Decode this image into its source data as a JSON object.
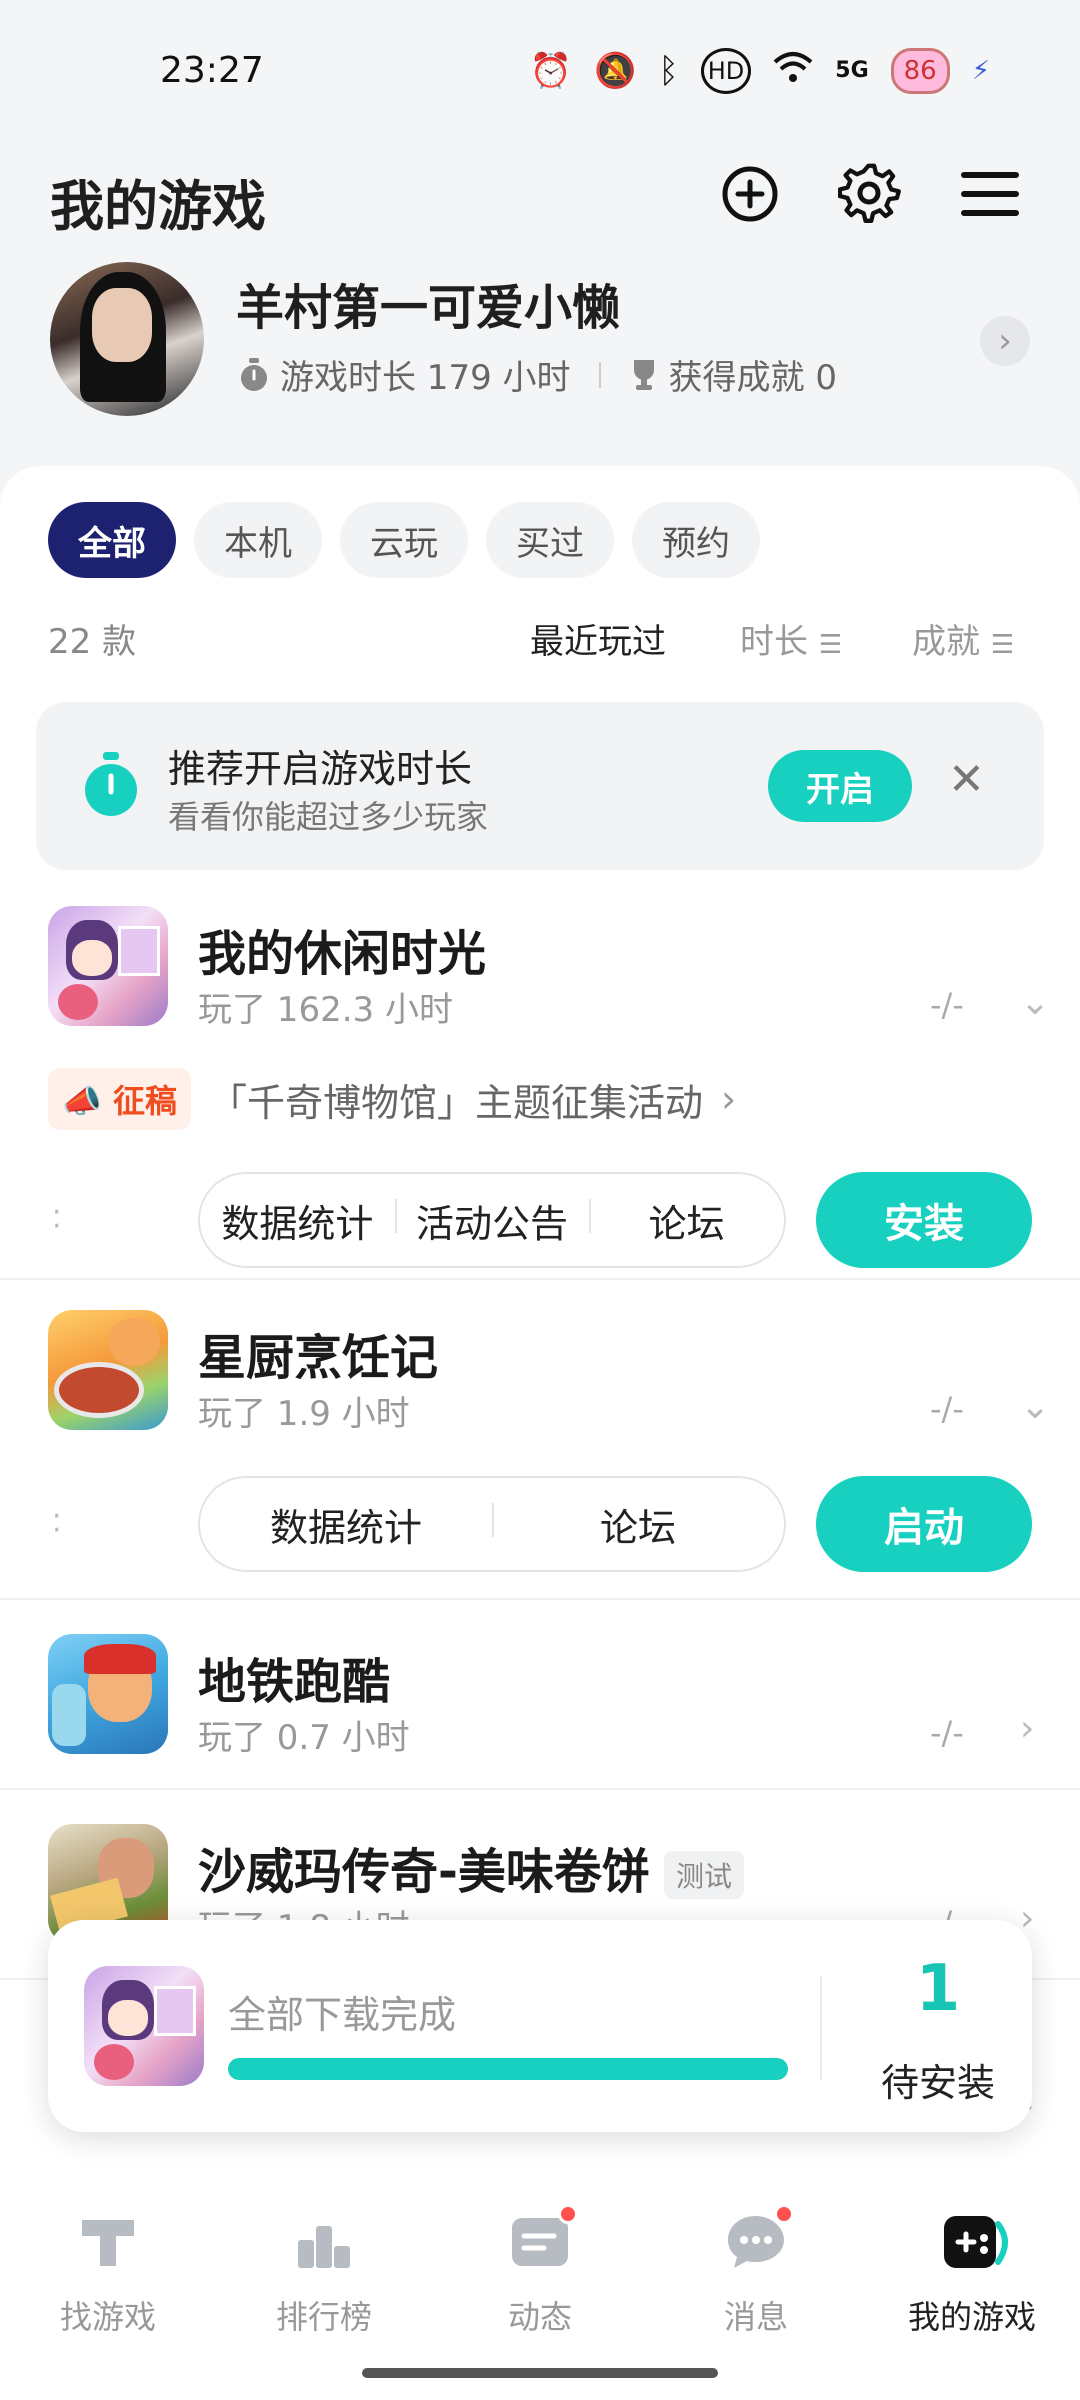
{
  "status_bar": {
    "time": "23:27",
    "network": "5G",
    "battery": "86"
  },
  "header": {
    "title": "我的游戏"
  },
  "profile": {
    "name": "羊村第一可爱小懒",
    "playtime_label": "游戏时长 179 小时",
    "achievement_label": "获得成就 0"
  },
  "tabs": [
    "全部",
    "本机",
    "云玩",
    "买过",
    "预约"
  ],
  "sort": {
    "count": "22 款",
    "recent": "最近玩过",
    "duration": "时长",
    "achievement": "成就"
  },
  "recommend": {
    "title": "推荐开启游戏时长",
    "subtitle": "看看你能超过多少玩家",
    "button": "开启"
  },
  "games": [
    {
      "name": "我的休闲时光",
      "played": "玩了 162.3 小时",
      "rank": "-/-",
      "promo_badge": "征稿",
      "promo_text": "「千奇博物馆」主题征集活动",
      "actions": [
        "数据统计",
        "活动公告",
        "论坛"
      ],
      "primary": "安装"
    },
    {
      "name": "星厨烹饪记",
      "played": "玩了 1.9 小时",
      "rank": "-/-",
      "actions": [
        "数据统计",
        "论坛"
      ],
      "primary": "启动"
    },
    {
      "name": "地铁跑酷",
      "played": "玩了 0.7 小时",
      "rank": "-/-"
    },
    {
      "name": "沙威玛传奇-美味卷饼",
      "tag": "测试",
      "played": "玩了 1.8 小时",
      "rank": "-/-"
    }
  ],
  "download": {
    "text": "全部下载完成",
    "progress": 1.0,
    "count": "1",
    "label": "待安装"
  },
  "nav": [
    "找游戏",
    "排行榜",
    "动态",
    "消息",
    "我的游戏"
  ],
  "colors": {
    "accent": "#18d0c0",
    "active_tab": "#1c2170",
    "promo": "#f04d1f",
    "badge_dot": "#ff4f4f"
  }
}
